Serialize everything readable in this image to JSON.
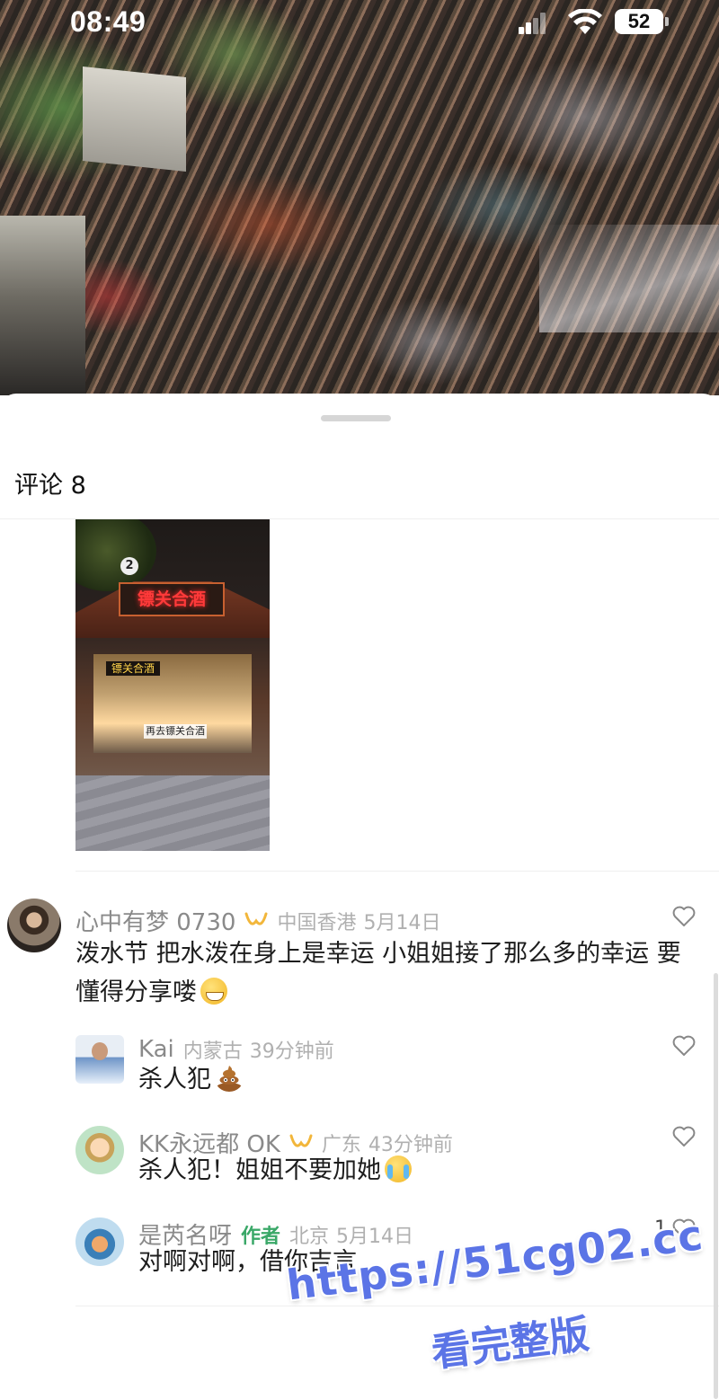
{
  "status_bar": {
    "time": "08:49",
    "battery": "52"
  },
  "comments_panel": {
    "title": "评论 8"
  },
  "image_comment": {
    "shop_caption": "再去镖关合酒"
  },
  "comments": [
    {
      "username": "心中有梦 0730",
      "location": "中国香港",
      "time": "5月14日",
      "text": "泼水节  把水泼在身上是幸运 小姐姐接了那么多的幸运  要懂得分享喽",
      "emoji": "grinning-sweat-emoji",
      "like_count": ""
    },
    {
      "username": "Kai",
      "location": "内蒙古",
      "time": "39分钟前",
      "text": "杀人犯",
      "emoji": "poop-emoji",
      "like_count": ""
    },
    {
      "username": "KK永远都 OK",
      "location": "广东",
      "time": "43分钟前",
      "text": "杀人犯！姐姐不要加她",
      "emoji": "crying-emoji",
      "like_count": ""
    },
    {
      "username": "是芮名呀",
      "author_tag": "作者",
      "location": "北京",
      "time": "5月14日",
      "text": "对啊对啊，借你吉言",
      "like_count": "1"
    }
  ],
  "watermark": {
    "url": "https://51cg02.cc",
    "subtitle": "看完整版"
  },
  "colors": {
    "accent": "#5b74e6",
    "author_green": "#3aa868",
    "meta_gray": "#b0b0b0"
  }
}
